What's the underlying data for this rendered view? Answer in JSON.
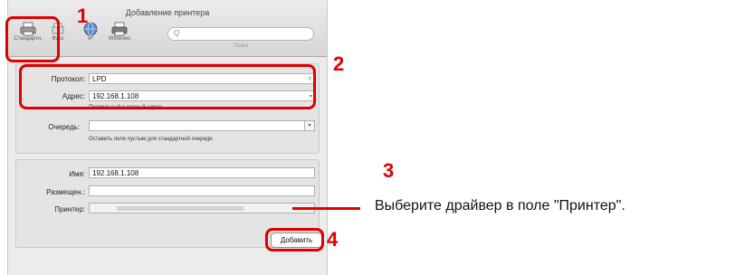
{
  "window": {
    "title": "Добавление принтера",
    "toolbar": [
      {
        "label": "Стандартн.",
        "icon": "printer-icon"
      },
      {
        "label": "Факс",
        "icon": "fax-icon"
      },
      {
        "label": "IP",
        "icon": "globe-icon"
      },
      {
        "label": "Windows",
        "icon": "printer-icon"
      }
    ],
    "search_icon": "Q",
    "search_label": "Поиск"
  },
  "form": {
    "protocol_label": "Протокол:",
    "protocol_value": "LPD",
    "address_label": "Адрес:",
    "address_value": "192.168.1.108",
    "address_hint": "Правильный и полный адрес.",
    "queue_label": "Очередь:",
    "queue_value": "",
    "queue_hint": "Оставить поле пустым для стандартной очереди.",
    "name_label": "Имя:",
    "name_value": "192.168.1.108",
    "location_label": "Размещен.:",
    "location_value": "",
    "printer_label": "Принтер:",
    "printer_value": ""
  },
  "add_button": "Добавить",
  "annotations": {
    "step1": "1",
    "step2": "2",
    "step3": "3",
    "step4": "4",
    "callout": "Выберите драйвер в поле \"Принтер\"."
  },
  "colors": {
    "annotation_red": "#e00000",
    "dialog_bg": "#ececec"
  }
}
